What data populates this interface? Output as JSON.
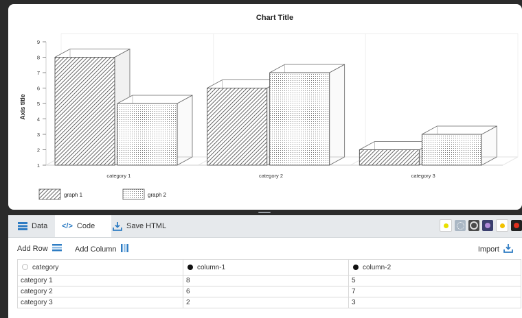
{
  "chart_data": {
    "type": "bar",
    "title": "Chart Title",
    "ylabel": "Axis title",
    "xlabel": "",
    "categories": [
      "category 1",
      "category 2",
      "category 3"
    ],
    "series": [
      {
        "name": "graph 1",
        "values": [
          8,
          6,
          2
        ]
      },
      {
        "name": "graph 2",
        "values": [
          5,
          7,
          3
        ]
      }
    ],
    "ylim": [
      1,
      9
    ],
    "yticks": [
      "1",
      "2",
      "3",
      "4",
      "5",
      "6",
      "7",
      "8",
      "9"
    ],
    "grid": true,
    "legend": "bottom-left",
    "style": "3d-bars-patterned"
  },
  "tabs": {
    "data": "Data",
    "code": "Code",
    "save_html": "Save HTML"
  },
  "toolbar": {
    "add_row": "Add Row",
    "add_column": "Add Column",
    "import": "Import"
  },
  "grid": {
    "headers": [
      "category",
      "column-1",
      "column-2"
    ],
    "rows": [
      [
        "category 1",
        "8",
        "5"
      ],
      [
        "category 2",
        "6",
        "7"
      ],
      [
        "category 3",
        "2",
        "3"
      ]
    ]
  },
  "colors": {
    "accent": "#2e7cc3",
    "tabbar": "#e6e9ec",
    "background": "#2b2b2b"
  }
}
